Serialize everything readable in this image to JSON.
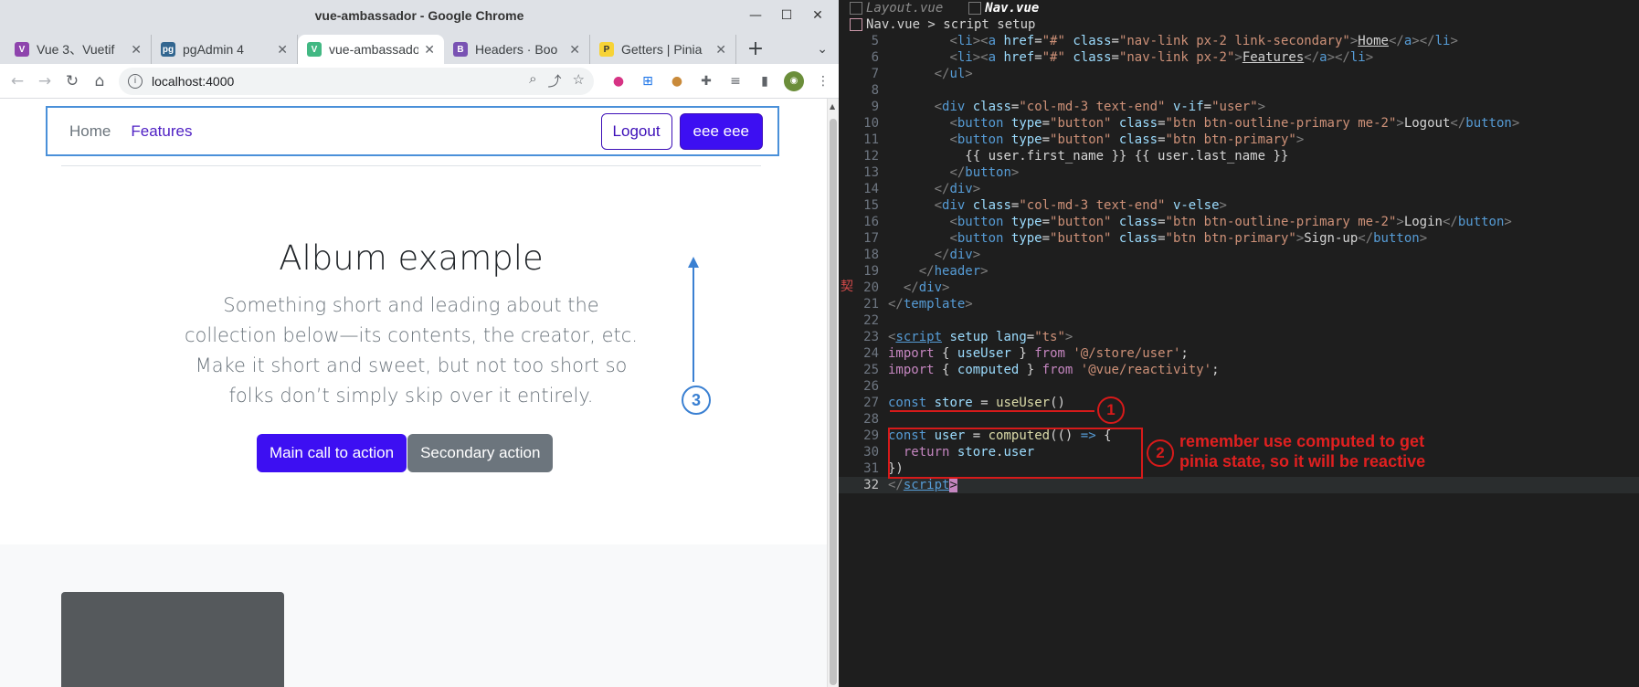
{
  "browser": {
    "window_title": "vue-ambassador - Google Chrome",
    "tabs": [
      {
        "label": "Vue 3、Vuetif",
        "color": "#8e44ad",
        "glyph": "V"
      },
      {
        "label": "pgAdmin 4",
        "color": "#326690",
        "glyph": "pg"
      },
      {
        "label": "vue-ambassador",
        "color": "#42b883",
        "glyph": "V",
        "active": true
      },
      {
        "label": "Headers · Boo",
        "color": "#7952b3",
        "glyph": "B"
      },
      {
        "label": "Getters | Pinia",
        "color": "#f7d336",
        "glyph": "P"
      }
    ],
    "url": "localhost:4000"
  },
  "page": {
    "nav": {
      "home": "Home",
      "features": "Features",
      "logout": "Logout",
      "user_button": "eee eee"
    },
    "hero": {
      "title": "Album example",
      "lead": "Something short and leading about the collection below—its contents, the creator, etc. Make it short and sweet, but not too short so folks don’t simply skip over it entirely.",
      "primary_cta": "Main call to action",
      "secondary_cta": "Secondary action"
    },
    "annotation_3": "3"
  },
  "editor": {
    "tabs": [
      "Layout.vue",
      "Nav.vue"
    ],
    "breadcrumb": "Nav.vue > script setup",
    "side_marker": "契",
    "annotations": {
      "one": "1",
      "two": "2",
      "note_line1": "remember use computed to get",
      "note_line2": "pinia state, so it will be reactive"
    }
  }
}
